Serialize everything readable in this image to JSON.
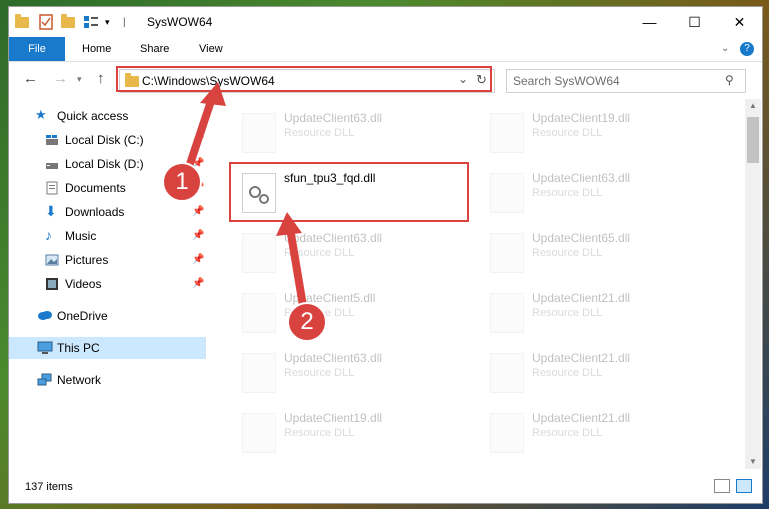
{
  "window": {
    "title": "SysWOW64"
  },
  "ribbon": {
    "tabs": [
      "File",
      "Home",
      "Share",
      "View"
    ]
  },
  "address": {
    "path": "C:\\Windows\\SysWOW64"
  },
  "search": {
    "placeholder": "Search SysWOW64"
  },
  "nav": {
    "items": [
      {
        "label": "Quick access",
        "icon": "star-icon",
        "pinned": false
      },
      {
        "label": "Local Disk (C:)",
        "icon": "drive-icon",
        "pinned": true
      },
      {
        "label": "Local Disk (D:)",
        "icon": "drive-icon",
        "pinned": true
      },
      {
        "label": "Documents",
        "icon": "documents-icon",
        "pinned": true
      },
      {
        "label": "Downloads",
        "icon": "downloads-icon",
        "pinned": true
      },
      {
        "label": "Music",
        "icon": "music-icon",
        "pinned": true
      },
      {
        "label": "Pictures",
        "icon": "pictures-icon",
        "pinned": true
      },
      {
        "label": "Videos",
        "icon": "videos-icon",
        "pinned": true
      },
      {
        "label": "OneDrive",
        "icon": "cloud-icon",
        "pinned": false
      },
      {
        "label": "This PC",
        "icon": "computer-icon",
        "pinned": false,
        "selected": true
      },
      {
        "label": "Network",
        "icon": "network-icon",
        "pinned": false
      }
    ]
  },
  "files": {
    "left": [
      {
        "name": "UpdateClient63.dll",
        "type": "Resource DLL"
      },
      {
        "name": "sfun_tpu3_fqd.dll",
        "type": ""
      },
      {
        "name": "UpdateClient63.dll",
        "type": "Resource DLL"
      },
      {
        "name": "UpdateClient5.dll",
        "type": "Resource DLL"
      },
      {
        "name": "UpdateClient63.dll",
        "type": "Resource DLL"
      },
      {
        "name": "UpdateClient19.dll",
        "type": "Resource DLL"
      }
    ],
    "right": [
      {
        "name": "UpdateClient19.dll",
        "type": "Resource DLL"
      },
      {
        "name": "UpdateClient63.dll",
        "type": "Resource DLL"
      },
      {
        "name": "UpdateClient65.dll",
        "type": "Resource DLL"
      },
      {
        "name": "UpdateClient21.dll",
        "type": "Resource DLL"
      },
      {
        "name": "UpdateClient21.dll",
        "type": "Resource DLL"
      },
      {
        "name": "UpdateClient21.dll",
        "type": "Resource DLL"
      }
    ]
  },
  "status": {
    "count": "137 items"
  },
  "annotations": {
    "step1": "1",
    "step2": "2"
  },
  "colors": {
    "accent": "#1979ca",
    "annotation": "#d8433f",
    "selection": "#cce8ff"
  }
}
